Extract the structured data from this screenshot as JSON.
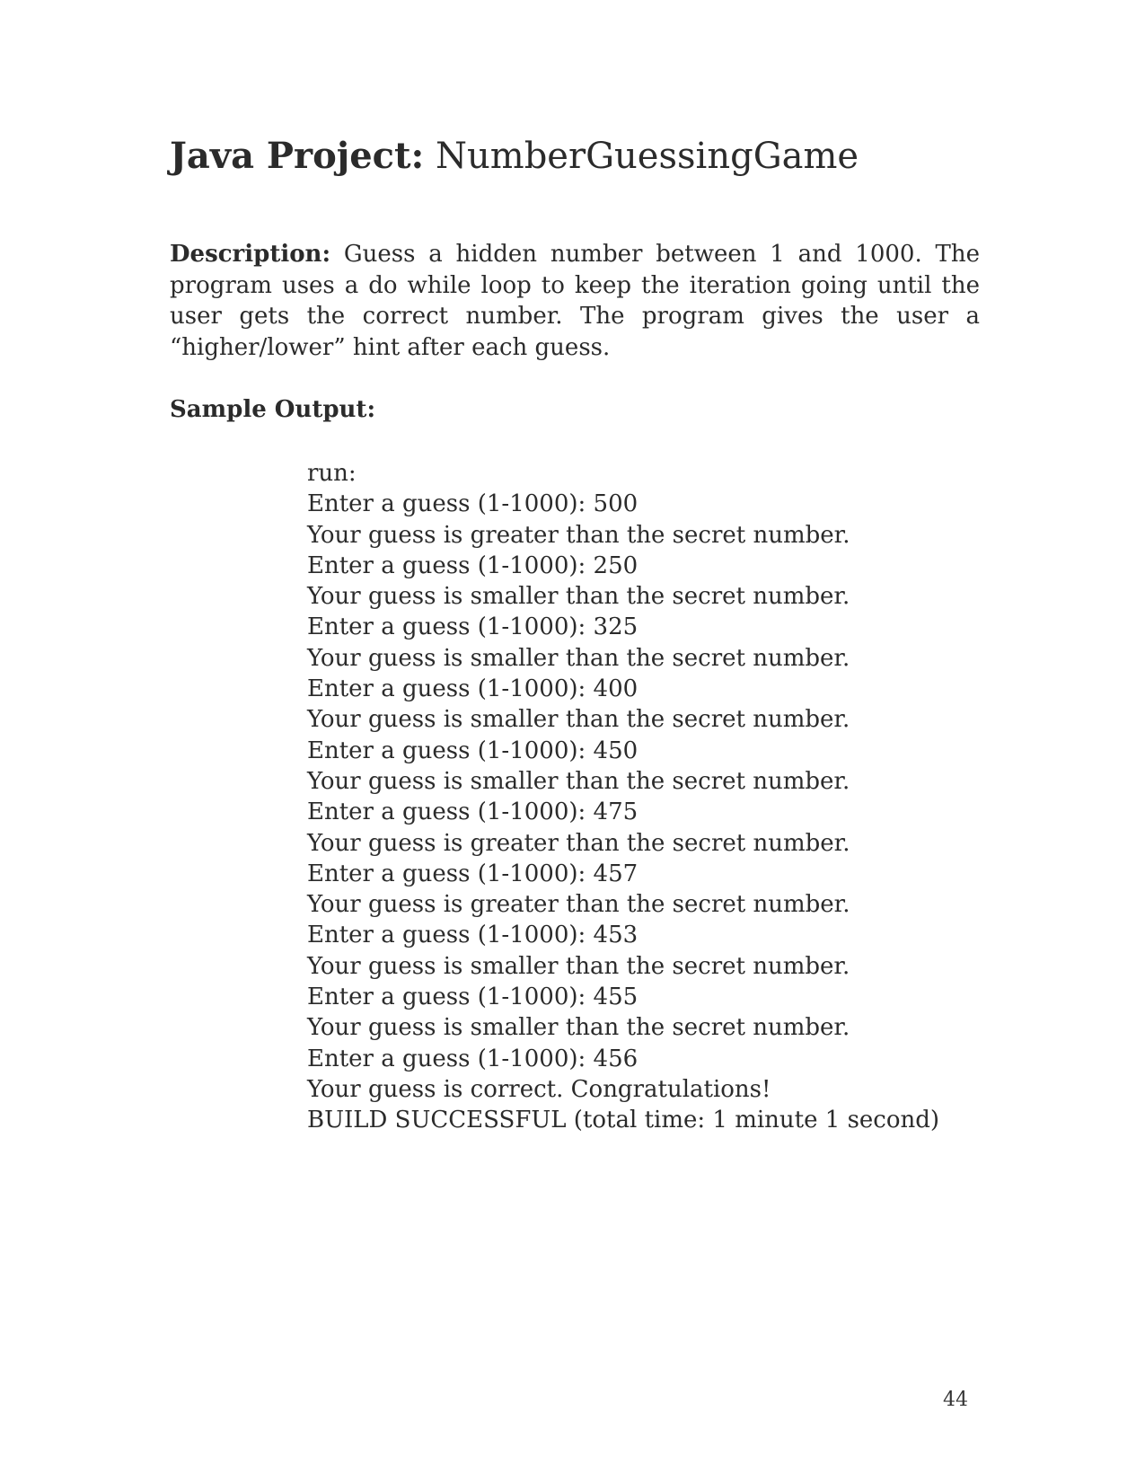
{
  "document": {
    "title_label": "Java Project:",
    "title_name": "NumberGuessingGame",
    "description_label": "Description:",
    "description_text": "Guess a hidden number between 1 and 1000.  The program uses a do while loop to keep the iteration going until the user gets the correct number.  The program gives the user a “higher/lower” hint after each guess.",
    "sample_output_heading": "Sample Output:",
    "sample_output_lines": [
      "run:",
      "Enter a guess (1-1000): 500",
      "Your guess is greater than the secret number.",
      "Enter a guess (1-1000): 250",
      "Your guess is smaller than the secret number.",
      "Enter a guess (1-1000): 325",
      "Your guess is smaller than the secret number.",
      "Enter a guess (1-1000): 400",
      "Your guess is smaller than the secret number.",
      "Enter a guess (1-1000): 450",
      "Your guess is smaller than the secret number.",
      "Enter a guess (1-1000): 475",
      "Your guess is greater than the secret number.",
      "Enter a guess (1-1000): 457",
      "Your guess is greater than the secret number.",
      "Enter a guess (1-1000): 453",
      "Your guess is smaller than the secret number.",
      "Enter a guess (1-1000): 455",
      "Your guess is smaller than the secret number.",
      "Enter a guess (1-1000): 456",
      "Your guess is correct. Congratulations!",
      "BUILD SUCCESSFUL (total time: 1 minute 1 second)"
    ],
    "page_number": "44"
  }
}
